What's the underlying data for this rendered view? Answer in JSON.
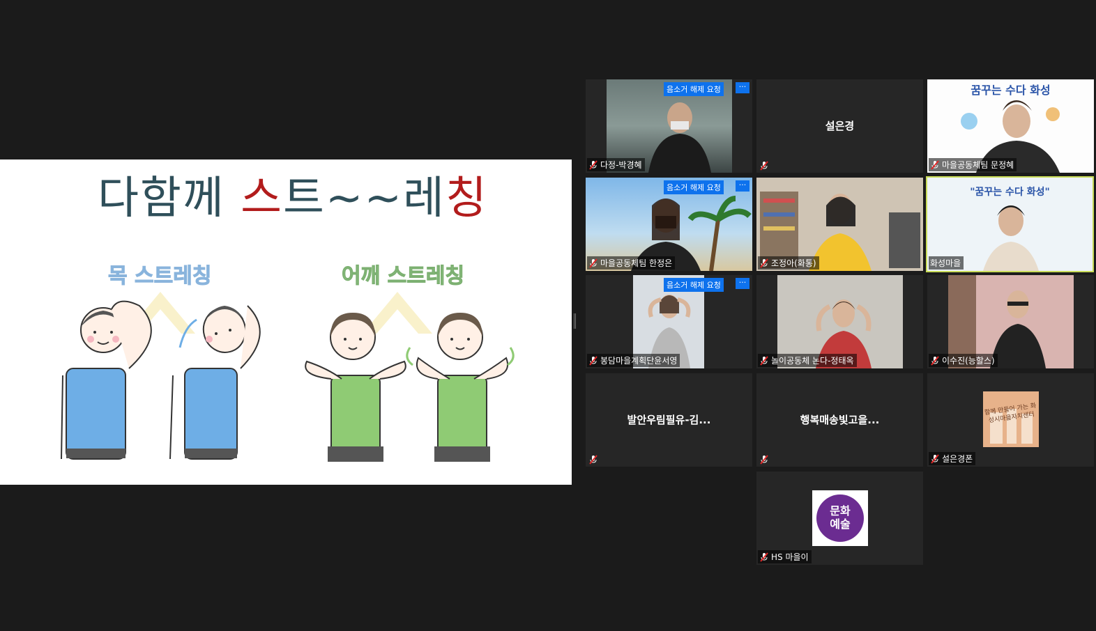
{
  "slide": {
    "title_part1": "다함께",
    "title_part2": "스",
    "title_part3": "트~~레",
    "title_part4": "칭",
    "neck_label": "목 스트레칭",
    "shoulder_label": "어깨 스트레칭"
  },
  "request_unmute_label": "음소거 해제 요청",
  "more_label": "···",
  "participants": [
    {
      "name": "다정-박경혜",
      "has_request": true
    },
    {
      "name": "설은경",
      "center": "설은경"
    },
    {
      "name": "마을공동체팀 문정혜",
      "banner": "꿈꾸는 수다 화성"
    },
    {
      "name": "마을공동체팀 한정은",
      "has_request": true
    },
    {
      "name": "조정아(화통)"
    },
    {
      "name": "화성마을",
      "banner": "\"꿈꾸는 수다 화성\""
    },
    {
      "name": "봉담마을계획단윤서영",
      "has_request": true
    },
    {
      "name": "놀이공동체 논다-정태옥"
    },
    {
      "name": "이수진(능할스)"
    },
    {
      "name": "",
      "center": "발안우림필유-김..."
    },
    {
      "name": "",
      "center": "행복매송빛고을..."
    },
    {
      "name": "설은경폰",
      "image_text": "함께 만들어 가는 화성시마을자치센터"
    },
    {
      "name": "HS 마을이",
      "logo_text1": "문화",
      "logo_text2": "예술"
    }
  ],
  "colors": {
    "accent": "#0e72ed",
    "active_border": "#c9dc58",
    "mic_muted": "#e02828"
  }
}
